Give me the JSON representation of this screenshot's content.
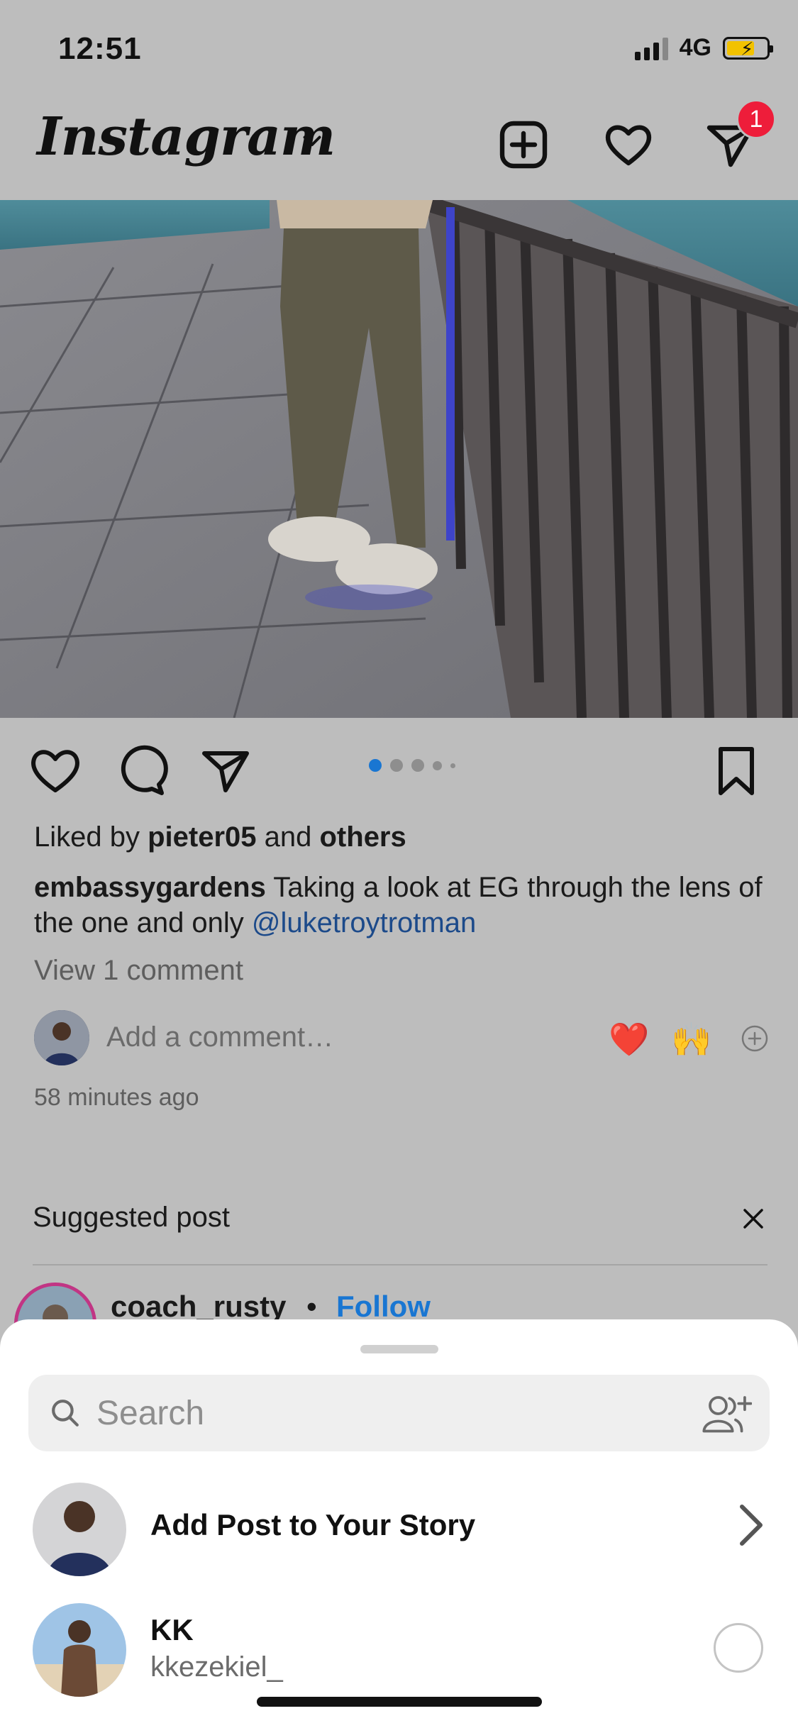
{
  "status_bar": {
    "time": "12:51",
    "network": "4G"
  },
  "header": {
    "logo": "Instagram",
    "icons": [
      "chevron-down-icon",
      "new-post-icon",
      "activity-heart-icon",
      "direct-message-icon"
    ],
    "dm_badge": "1"
  },
  "post": {
    "likes_prefix": "Liked by ",
    "likes_user": "pieter05",
    "likes_middle": " and ",
    "likes_suffix": "others",
    "caption_user": "embassygardens",
    "caption_text": " Taking a look at EG through the lens of the one and only ",
    "caption_mention": "@luketroytrotman",
    "view_comments": "View 1 comment",
    "comment_placeholder": "Add a comment…",
    "quick_emojis": [
      "❤️",
      "🙌"
    ],
    "timestamp": "58 minutes ago",
    "carousel_count": 5,
    "carousel_active": 1
  },
  "suggested": {
    "title": "Suggested post",
    "username": "coach_rusty",
    "separator": "•",
    "follow_label": "Follow"
  },
  "share_sheet": {
    "search_placeholder": "Search",
    "story_label": "Add Post to Your Story",
    "contacts": [
      {
        "name": "KK",
        "handle": "kkezekiel_"
      }
    ]
  },
  "colors": {
    "accent_blue": "#1976d2",
    "badge_red": "#ee1d3a",
    "mention_blue": "#1c4a8a"
  }
}
